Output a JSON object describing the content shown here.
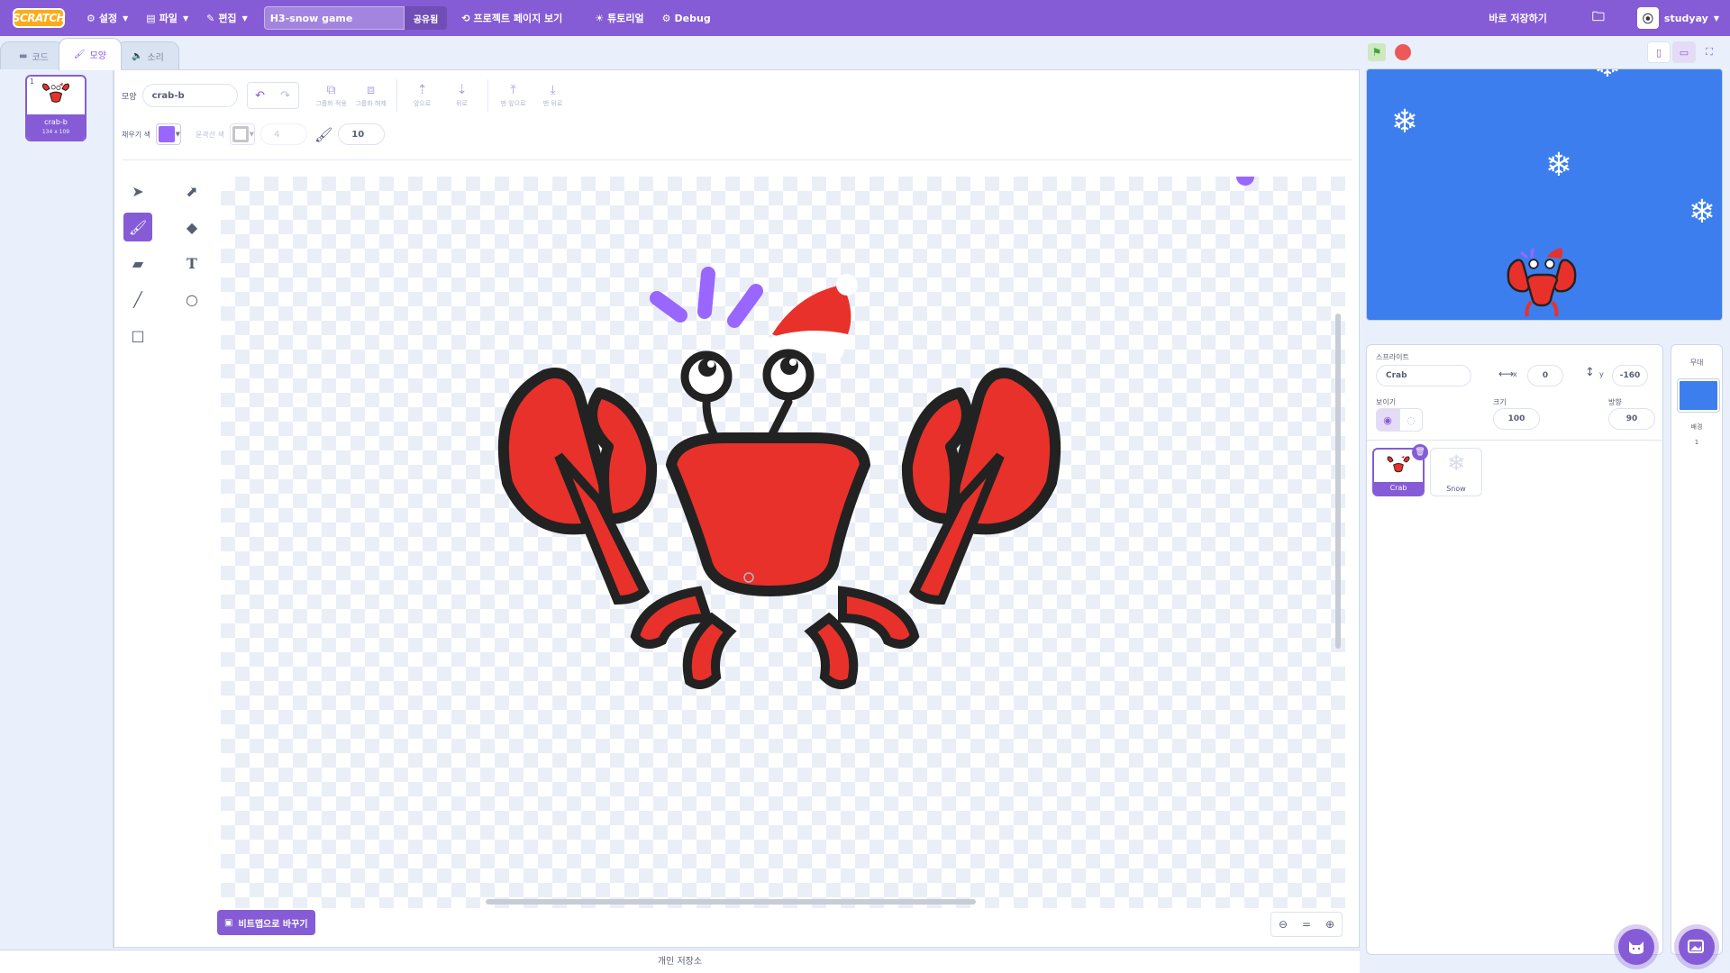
{
  "menubar": {
    "logo": "SCRATCH",
    "settings": "설정",
    "file": "파일",
    "edit": "편집",
    "project_title": "H3-snow game",
    "share": "공유됨",
    "see_project_page": "프로젝트 페이지 보기",
    "tutorials": "튜토리얼",
    "debug": "Debug",
    "save_now": "바로 저장하기",
    "username": "studyay"
  },
  "tabs": {
    "code": "코드",
    "costumes": "모양",
    "sounds": "소리"
  },
  "costume_list": {
    "items": [
      {
        "number": "1",
        "name": "crab-b",
        "size": "134 x 109"
      }
    ]
  },
  "paint_editor": {
    "costume_label": "모양",
    "costume_name": "crab-b",
    "group": "그룹화 적용",
    "ungroup": "그룹화 해제",
    "forward": "앞으로",
    "backward": "뒤로",
    "front": "맨 앞으로",
    "back": "맨 뒤로",
    "fill_label": "채우기 색",
    "fill_color": "#9966ff",
    "outline_label": "윤곽선 색",
    "outline_width": "4",
    "brush_size": "10",
    "convert_bitmap": "비트맵으로 바꾸기",
    "zoom_reset": "="
  },
  "backpack_label": "개인 저장소",
  "sprite_info": {
    "sprite_label": "스프라이트",
    "sprite_name": "Crab",
    "x_label": "x",
    "x_value": "0",
    "y_label": "y",
    "y_value": "-160",
    "show_label": "보이기",
    "size_label": "크기",
    "size_value": "100",
    "direction_label": "방향",
    "direction_value": "90"
  },
  "sprites": [
    {
      "name": "Crab",
      "selected": true
    },
    {
      "name": "Snow",
      "selected": false
    }
  ],
  "stage_pane": {
    "title": "무대",
    "backdrops_label": "배경",
    "backdrop_count": "1"
  },
  "colors": {
    "accent": "#855cd6",
    "stage_blue": "#3d7eee",
    "crab_red": "#e8312a"
  }
}
